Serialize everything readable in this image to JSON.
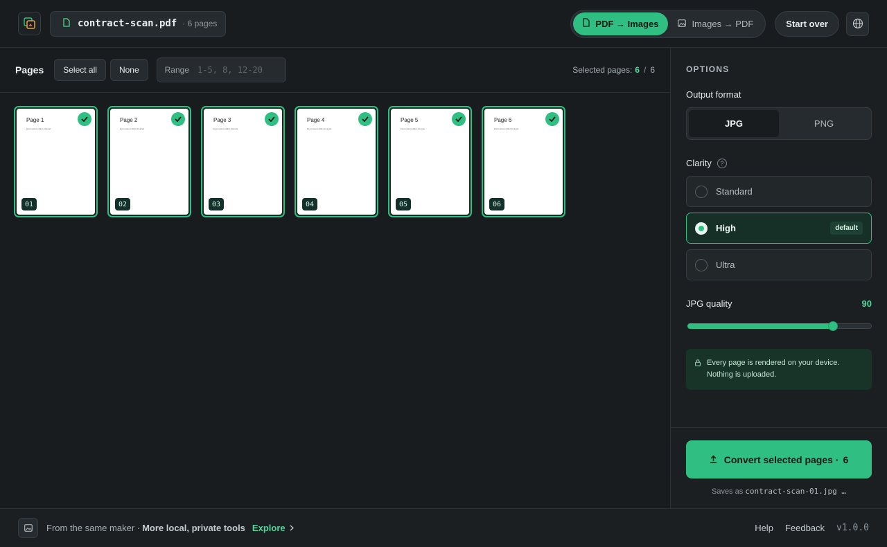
{
  "header": {
    "file_name": "contract-scan.pdf",
    "file_pages": "· 6 pages",
    "modes": [
      {
        "label": "PDF → Images",
        "active": true
      },
      {
        "label": "Images → PDF",
        "active": false
      }
    ],
    "start_over": "Start over"
  },
  "toolbar": {
    "pages_label": "Pages",
    "select_all": "Select all",
    "none": "None",
    "range_label": "Range",
    "range_placeholder": "1-5, 8, 12-20",
    "selected_label": "Selected pages:",
    "selected_count": "6",
    "separator": "/",
    "total_count": "6"
  },
  "pages": [
    {
      "title": "Page 1",
      "text": "lorem ipsum dolor sit amet",
      "num": "01",
      "selected": true
    },
    {
      "title": "Page 2",
      "text": "lorem ipsum dolor sit amet",
      "num": "02",
      "selected": true
    },
    {
      "title": "Page 3",
      "text": "lorem ipsum dolor sit amet",
      "num": "03",
      "selected": true
    },
    {
      "title": "Page 4",
      "text": "lorem ipsum dolor sit amet",
      "num": "04",
      "selected": true
    },
    {
      "title": "Page 5",
      "text": "lorem ipsum dolor sit amet",
      "num": "05",
      "selected": true
    },
    {
      "title": "Page 6",
      "text": "lorem ipsum dolor sit amet",
      "num": "06",
      "selected": true
    }
  ],
  "options": {
    "heading": "OPTIONS",
    "output_format_label": "Output format",
    "formats": [
      {
        "label": "JPG",
        "active": true
      },
      {
        "label": "PNG",
        "active": false
      }
    ],
    "clarity_label": "Clarity",
    "clarity_help": "?",
    "clarity_options": [
      {
        "label": "Standard",
        "selected": false,
        "badge": ""
      },
      {
        "label": "High",
        "selected": true,
        "badge": "default"
      },
      {
        "label": "Ultra",
        "selected": false,
        "badge": ""
      }
    ],
    "quality_label": "JPG quality",
    "quality_value": "90",
    "quality_fraction": 0.79,
    "note_line1": "Every page is rendered on your device.",
    "note_line2": "Nothing is uploaded."
  },
  "convert": {
    "label": "Convert selected pages ·",
    "count": "6",
    "saves_prefix": "Saves as",
    "saves_file": "contract-scan-01.jpg …"
  },
  "footer": {
    "from": "From the same maker ·",
    "tools": "More local, private tools",
    "explore": "Explore",
    "help": "Help",
    "feedback": "Feedback",
    "version": "v1.0.0"
  },
  "colors": {
    "accent": "#2fbf82",
    "background": "#181c1f",
    "panel": "#1b1f22"
  }
}
